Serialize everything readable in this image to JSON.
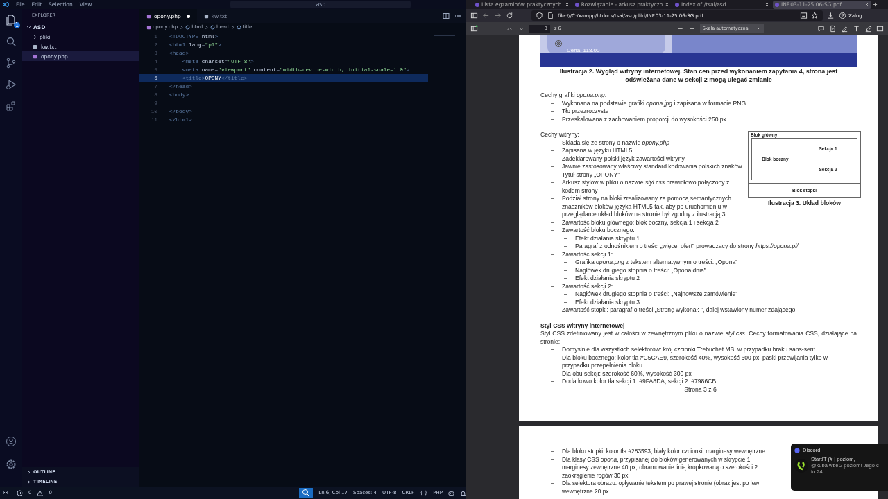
{
  "vscode": {
    "menu": [
      "File",
      "Edit",
      "Selection",
      "View"
    ],
    "command_center": "asd",
    "explorer": {
      "title": "EXPLORER",
      "more": "···",
      "folder": {
        "label": "ASD",
        "expanded": true,
        "children": [
          {
            "label": "pliki",
            "kind": "folder",
            "expanded": false,
            "selected": false
          },
          {
            "label": "kw.txt",
            "kind": "text",
            "selected": false
          },
          {
            "label": "opony.php",
            "kind": "php",
            "selected": true
          }
        ]
      },
      "panels": [
        {
          "label": "OUTLINE",
          "expanded": false
        },
        {
          "label": "TIMELINE",
          "expanded": false
        }
      ]
    },
    "explorer_badge": "1",
    "tabs": [
      {
        "label": "opony.php",
        "kind": "php",
        "selected": true,
        "modified": true
      },
      {
        "label": "kw.txt",
        "kind": "text",
        "selected": false,
        "modified": false
      }
    ],
    "breadcrumb": [
      {
        "label": "opony.php",
        "kind": "php"
      },
      {
        "label": "html",
        "kind": "element"
      },
      {
        "label": "head",
        "kind": "element"
      },
      {
        "label": "title",
        "kind": "element"
      }
    ],
    "code": [
      {
        "number": "1",
        "selected": false,
        "tokens": [
          {
            "kind": "tag",
            "text": "<!DOCTYPE"
          },
          {
            "kind": "attr",
            "text": " html"
          },
          {
            "kind": "tag",
            "text": ">"
          }
        ]
      },
      {
        "number": "2",
        "selected": false,
        "tokens": [
          {
            "kind": "tag",
            "text": "<html"
          },
          {
            "kind": "attr",
            "text": " lang"
          },
          {
            "kind": "punct",
            "text": "="
          },
          {
            "kind": "string",
            "text": "\"pl\""
          },
          {
            "kind": "tag",
            "text": ">"
          }
        ]
      },
      {
        "number": "3",
        "selected": false,
        "tokens": [
          {
            "kind": "tag",
            "text": "<head>"
          }
        ]
      },
      {
        "number": "4",
        "selected": false,
        "tokens": [
          {
            "kind": "tag",
            "text": "    <meta"
          },
          {
            "kind": "attr",
            "text": " charset"
          },
          {
            "kind": "punct",
            "text": "="
          },
          {
            "kind": "string",
            "text": "\"UTF-8\""
          },
          {
            "kind": "tag",
            "text": ">"
          }
        ]
      },
      {
        "number": "5",
        "selected": false,
        "tokens": [
          {
            "kind": "tag",
            "text": "    <meta"
          },
          {
            "kind": "attr",
            "text": " name"
          },
          {
            "kind": "punct",
            "text": "="
          },
          {
            "kind": "string",
            "text": "\"viewport\""
          },
          {
            "kind": "attr",
            "text": " content"
          },
          {
            "kind": "punct",
            "text": "="
          },
          {
            "kind": "string",
            "text": "\"width=device-width, initial-scale=1.0\""
          },
          {
            "kind": "tag",
            "text": ">"
          }
        ]
      },
      {
        "number": "6",
        "selected": true,
        "tokens": [
          {
            "kind": "tag",
            "text": "    <title>"
          },
          {
            "kind": "text",
            "text": "OPONY"
          },
          {
            "kind": "tag",
            "text": "</title>"
          }
        ]
      },
      {
        "number": "7",
        "selected": false,
        "tokens": [
          {
            "kind": "tag",
            "text": "</head>"
          }
        ]
      },
      {
        "number": "8",
        "selected": false,
        "tokens": [
          {
            "kind": "tag",
            "text": "<body>"
          }
        ]
      },
      {
        "number": "9",
        "selected": false
      },
      {
        "number": "10",
        "selected": false,
        "tokens": [
          {
            "kind": "tag",
            "text": "</body>"
          }
        ]
      },
      {
        "number": "11",
        "selected": false,
        "tokens": [
          {
            "kind": "tag",
            "text": "</html>"
          }
        ]
      }
    ],
    "status": {
      "errors": "0",
      "warnings": "0",
      "items": [
        "Ln 6, Col 17",
        "Spaces: 4",
        "UTF-8",
        "CRLF"
      ],
      "language_icon": "{ }",
      "language": "PHP"
    }
  },
  "browser": {
    "tabs": [
      {
        "label": "Lista egzaminów praktycznych",
        "selected": false
      },
      {
        "label": "Rozwiązanie - arkusz praktyczn",
        "selected": false
      },
      {
        "label": "Index of /tsai/asd",
        "selected": false
      },
      {
        "label": "INF.03-11-25.06-SG.pdf",
        "selected": true
      }
    ],
    "url": "file:///C:/xampp/htdocs/tsai/asd/pliki/INF.03-11-25.06-SG.pdf",
    "account": "Zalog",
    "pdf_toolbar": {
      "page": "3",
      "page_count": "z 6",
      "zoom": "Skala automatyczna"
    },
    "bullet": "–",
    "page": {
      "preview": {
        "price": "Cena: 118.00"
      },
      "caption": "Ilustracja 2. Wygląd witryny internetowej. Stan cen przed wykonaniem zapytania 4, strona jest odświeżana dane w sekcji 2 mogą ulegać zmianie",
      "blocks": [
        {
          "kind": "list",
          "title": "Cechy grafiki *opona.png*:",
          "items": [
            {
              "text": "Wykonana na podstawie grafiki *opona.jpg* i zapisana w formacie PNG"
            },
            {
              "text": "Tło przezroczyste"
            },
            {
              "text": "Przeskalowana z zachowaniem proporcji do wysokości 250 px"
            }
          ]
        },
        {
          "kind": "list",
          "title": "Cechy witryny:",
          "diagram": {
            "main": "Blok główny",
            "side": "Blok boczny",
            "section_1": "Sekcja 1",
            "section_2": "Sekcja 2",
            "footer": "Blok stopki",
            "caption": "Ilustracja 3. Układ bloków"
          },
          "items": [
            {
              "text": "Składa się ze strony o nazwie *opony.php*"
            },
            {
              "text": "Zapisana w języku HTML5"
            },
            {
              "text": "Zadeklarowany polski język zawartości witryny"
            },
            {
              "text": "Jawnie zastosowany właściwy standard kodowania polskich znaków"
            },
            {
              "text": "Tytuł strony „OPONY”"
            },
            {
              "text": "Arkusz stylów w pliku o nazwie *styl.css* prawidłowo połączony z kodem strony"
            },
            {
              "text": "Podział strony na bloki zrealizowany za pomocą semantycznych znaczników bloków języka HTML5 tak, aby po uruchomieniu w przeglądarce układ bloków na stronie był zgodny z ilustracją 3"
            },
            {
              "text": "Zawartość bloku głównego: blok boczny, sekcja 1 i sekcja 2"
            },
            {
              "text": "Zawartość bloku bocznego:",
              "children": [
                {
                  "text": "Efekt działania skryptu 1"
                },
                {
                  "text": "Paragraf z odnośnikiem o treści „więcej ofert” prowadzący do strony *https://opona.pl/*"
                }
              ]
            },
            {
              "text": "Zawartość sekcji 1:",
              "children": [
                {
                  "text": "Grafika *opona.png* z tekstem alternatywnym o treści: „Opona”"
                },
                {
                  "text": "Nagłówek drugiego stopnia o treści: „Opona dnia”"
                },
                {
                  "text": "Efekt działania skryptu 2"
                }
              ]
            },
            {
              "text": "Zawartość sekcji 2:",
              "children": [
                {
                  "text": "Nagłówek drugiego stopnia o treści: „Najnowsze zamówienie”"
                },
                {
                  "text": "Efekt działania skryptu 3"
                }
              ]
            },
            {
              "text": "Zawartość stopki: paragraf o treści „Stronę wykonał: ”, dalej wstawiony numer zdającego"
            }
          ]
        },
        {
          "kind": "section",
          "heading": "Styl CSS witryny internetowej",
          "intro": "Styl CSS zdefiniowany jest w całości w zewnętrznym pliku o nazwie *styl.css*. Cechy formatowania CSS, działające na stronie:",
          "items": [
            {
              "text": "Domyślnie dla wszystkich selektorów: krój czcionki Trebuchet MS, w przypadku braku sans-serif"
            },
            {
              "text": "Dla bloku bocznego: kolor tła #C5CAE9, szerokość 40%, wysokość 600 px, paski przewijania tylko w przypadku przepełnienia bloku"
            },
            {
              "text": "Dla obu sekcji: szerokość 60%, wysokość 300 px"
            },
            {
              "text": "Dodatkowo kolor tła sekcji 1: #9FA8DA, sekcji 2: #7986CB"
            }
          ]
        }
      ],
      "page_number": "Strona 3 z 6"
    },
    "next_page": [
      {
        "lines": [
          "Dla bloku stopki: kolor tła #283593, biały kolor czcionki, marginesy wewnętrzne"
        ]
      },
      {
        "lines": [
          "Dla klasy CSS *opona*, przypisanej do bloków generowanych w skrypcie 1",
          "marginesy zewnętrzne 40 px, obramowanie linią kropkowaną o szerokości 2",
          "zaokrąglenie rogów 30 px"
        ]
      },
      {
        "lines": [
          "Dla selektora obrazu: opływanie tekstem po prawej stronie (obraz jest po lew",
          "wewnętrzne 20 px"
        ]
      }
    ]
  },
  "notification": {
    "app": "Discord",
    "title": "StartIT (# | poziom,",
    "message": [
      "@kuba wbił 2 poziom! Jego c",
      "to 24"
    ]
  }
}
